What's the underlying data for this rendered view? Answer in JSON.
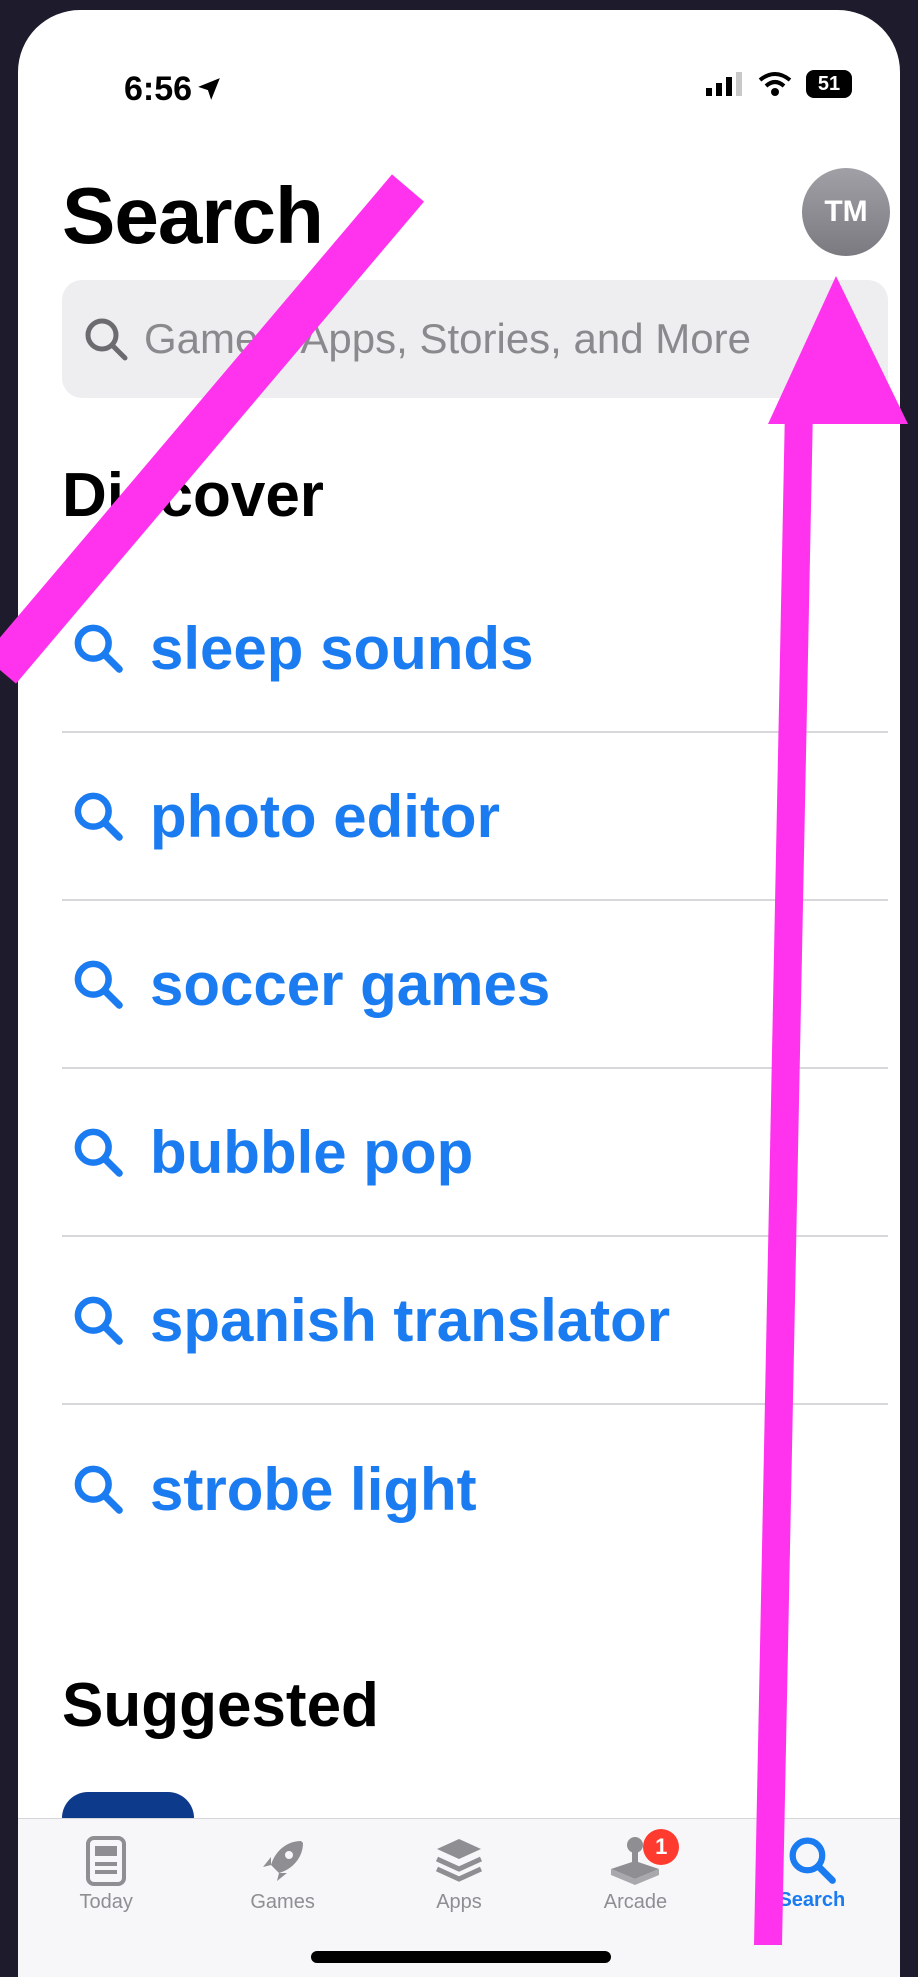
{
  "status_bar": {
    "time": "6:56",
    "battery": "51"
  },
  "header": {
    "title": "Search",
    "avatar_initials": "TM"
  },
  "search": {
    "placeholder": "Games, Apps, Stories, and More"
  },
  "discover": {
    "heading": "Discover",
    "items": [
      {
        "label": "sleep sounds"
      },
      {
        "label": "photo editor"
      },
      {
        "label": "soccer games"
      },
      {
        "label": "bubble pop"
      },
      {
        "label": "spanish translator"
      },
      {
        "label": "strobe light"
      }
    ]
  },
  "suggested": {
    "heading": "Suggested"
  },
  "tabbar": {
    "tabs": [
      {
        "label": "Today",
        "icon": "today-icon"
      },
      {
        "label": "Games",
        "icon": "rocket-icon"
      },
      {
        "label": "Apps",
        "icon": "stack-icon"
      },
      {
        "label": "Arcade",
        "icon": "joystick-icon",
        "badge": "1"
      },
      {
        "label": "Search",
        "icon": "search-icon",
        "active": true
      }
    ]
  },
  "colors": {
    "accent": "#1a7cf0",
    "annotation": "#ff33ee",
    "badge": "#ff3b30"
  }
}
